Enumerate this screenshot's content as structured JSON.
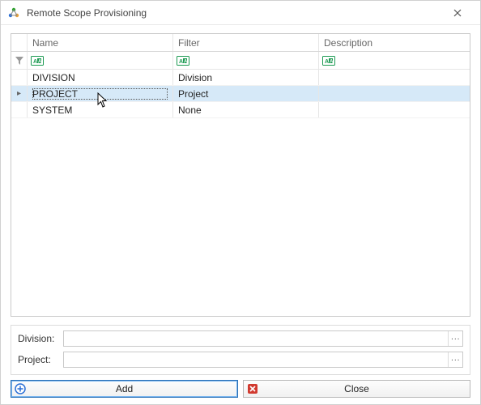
{
  "window": {
    "title": "Remote Scope Provisioning"
  },
  "grid": {
    "headers": {
      "name": "Name",
      "filter": "Filter",
      "description": "Description"
    },
    "rows": [
      {
        "name": "DIVISION",
        "filter": "Division",
        "description": "",
        "selected": false,
        "current": false
      },
      {
        "name": "PROJECT",
        "filter": "Project",
        "description": "",
        "selected": true,
        "current": true
      },
      {
        "name": "SYSTEM",
        "filter": "None",
        "description": "",
        "selected": false,
        "current": false
      }
    ]
  },
  "form": {
    "division_label": "Division:",
    "project_label": "Project:",
    "division_value": "",
    "project_value": ""
  },
  "buttons": {
    "add": "Add",
    "close": "Close"
  }
}
